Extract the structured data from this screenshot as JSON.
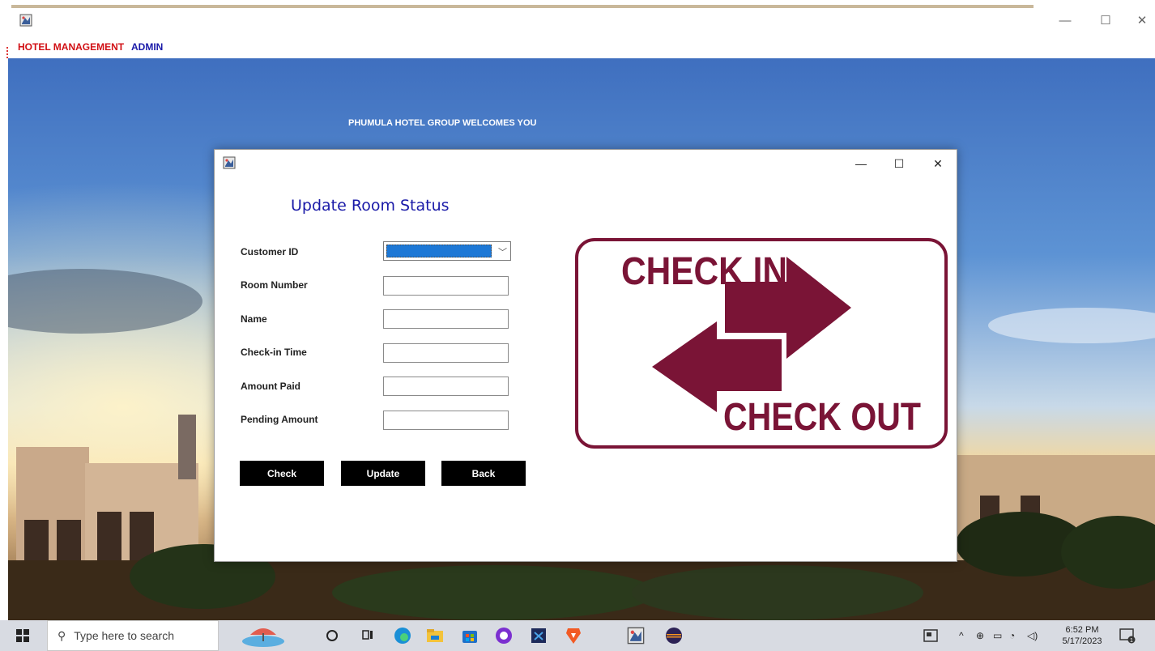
{
  "main_window": {
    "menu": {
      "hotel_management": "HOTEL MANAGEMENT",
      "admin": "ADMIN"
    },
    "controls": {
      "minimize": "—",
      "maximize": "☐",
      "close": "✕"
    }
  },
  "background": {
    "welcome_text": "PHUMULA HOTEL GROUP WELCOMES YOU"
  },
  "dialog": {
    "title": "Update Room Status",
    "controls": {
      "minimize": "—",
      "maximize": "☐",
      "close": "✕"
    },
    "fields": [
      {
        "label": "Customer ID",
        "type": "select",
        "value": ""
      },
      {
        "label": "Room Number",
        "type": "text",
        "value": ""
      },
      {
        "label": "Name",
        "type": "text",
        "value": ""
      },
      {
        "label": "Check-in Time",
        "type": "text",
        "value": ""
      },
      {
        "label": "Amount Paid",
        "type": "text",
        "value": ""
      },
      {
        "label": "Pending Amount",
        "type": "text",
        "value": ""
      }
    ],
    "buttons": {
      "check": "Check",
      "update": "Update",
      "back": "Back"
    },
    "image": {
      "top_text": "CHECK IN",
      "bottom_text": "CHECK OUT",
      "color": "#7a1436"
    }
  },
  "taskbar": {
    "search_placeholder": "Type here to search",
    "time": "6:52 PM",
    "date": "5/17/2023",
    "notification_count": "1",
    "icons": [
      "windows-start-icon",
      "cortana-icon",
      "task-view-icon",
      "edge-icon",
      "file-explorer-icon",
      "store-icon",
      "github-icon",
      "vscode-icon",
      "brave-icon",
      "java-app-icon",
      "eclipse-icon"
    ]
  }
}
